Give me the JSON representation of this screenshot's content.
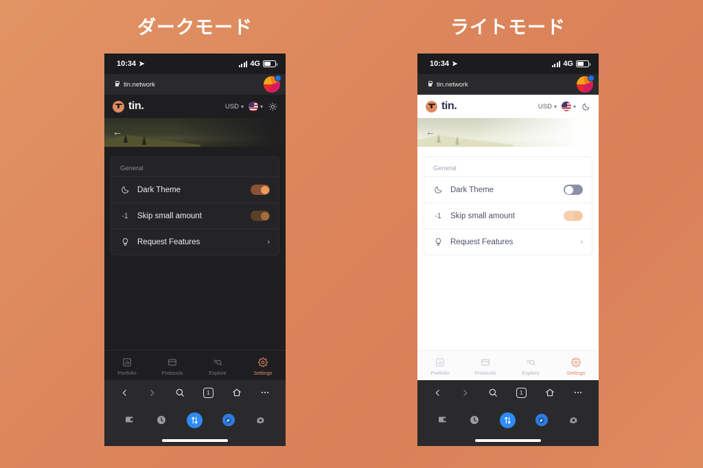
{
  "captions": {
    "dark": "ダークモード",
    "light": "ライトモード"
  },
  "colors": {
    "background_start": "#e09464",
    "background_end": "#de8a5f",
    "accent": "#e08a5f",
    "dark_surface": "#242427",
    "dark_bg": "#1e1e20",
    "light_bg": "#ffffff",
    "toggle_on_dark": "#ee9a5f",
    "toggle_off_light": "#8b90a8",
    "browser_chrome": "#2a2a2c",
    "wallet_blue": "#2f8bf5"
  },
  "status_bar": {
    "time": "10:34",
    "location_icon": "location-arrow-icon",
    "signal_icon": "signal-bars-icon",
    "network": "4G",
    "battery_icon": "battery-icon"
  },
  "url_bar": {
    "lock_icon": "lock-icon",
    "url": "tin.network",
    "profile_icon": "site-profile-logo-icon"
  },
  "app_header": {
    "brand": "tin.",
    "brand_icon": "tin-logo-icon",
    "currency": "USD",
    "currency_chevron": "chevron-down-icon",
    "language_flag": "us-flag-icon",
    "language_chevron": "chevron-down-icon",
    "theme_toggle_dark": "sun-icon",
    "theme_toggle_light": "moon-icon"
  },
  "banner": {
    "back_icon": "back-arrow-icon"
  },
  "settings_card": {
    "section_title": "General",
    "rows": [
      {
        "icon": "moon-icon",
        "label": "Dark Theme",
        "control": "toggle",
        "state_dark": "on",
        "state_light": "off"
      },
      {
        "icon": "minus-one-icon",
        "icon_text": "-1",
        "label": "Skip small amount",
        "control": "toggle",
        "state_dark": "on",
        "state_light": "on"
      },
      {
        "icon": "lightbulb-icon",
        "label": "Request Features",
        "control": "chevron",
        "chevron": "chevron-right-icon"
      }
    ]
  },
  "bottom_nav": {
    "items": [
      {
        "label": "Portfolio",
        "icon": "portfolio-chart-icon",
        "active": false
      },
      {
        "label": "Protocols",
        "icon": "protocols-card-icon",
        "active": false
      },
      {
        "label": "Explore",
        "icon": "explore-search-icon",
        "active": false
      },
      {
        "label": "Settings",
        "icon": "settings-gear-icon",
        "active": true
      }
    ]
  },
  "browser_toolbar": {
    "back": "back-icon",
    "forward": "forward-icon",
    "search": "search-icon",
    "tabs_count": "1",
    "tabs": "tabs-icon",
    "home": "home-icon",
    "more": "more-icon"
  },
  "wallet_toolbar": {
    "items": [
      {
        "icon": "wallet-icon",
        "highlight": "none"
      },
      {
        "icon": "history-clock-icon",
        "highlight": "none"
      },
      {
        "icon": "swap-arrows-icon",
        "highlight": "blue"
      },
      {
        "icon": "compass-icon",
        "highlight": "blue2"
      },
      {
        "icon": "gear-icon",
        "highlight": "none"
      }
    ]
  }
}
